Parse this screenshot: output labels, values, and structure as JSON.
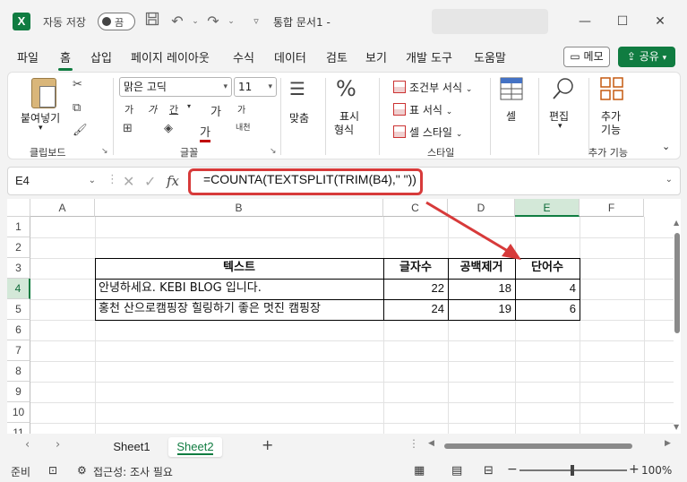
{
  "titlebar": {
    "app_logo": "X",
    "autosave_label": "자동 저장",
    "autosave_toggle": "끔",
    "doc_title": "통합 문서1",
    "doc_title_suffix": "-",
    "icons": [
      "save-icon",
      "undo-icon",
      "redo-icon"
    ]
  },
  "menu": {
    "tabs": [
      "파일",
      "홈",
      "삽입",
      "페이지 레이아웃",
      "수식",
      "데이터",
      "검토",
      "보기",
      "개발 도구",
      "도움말"
    ],
    "active_tab": "홈",
    "memo_label": "메모",
    "share_label": "공유"
  },
  "ribbon": {
    "clipboard": {
      "paste_label": "붙여넣기",
      "group_label": "클립보드"
    },
    "font": {
      "font_name": "맑은 고딕",
      "font_size": "11",
      "grow": "가",
      "shrink": "가",
      "underline": "간",
      "bold": "가",
      "italic": "가",
      "font_color_char": "가",
      "phonetic": "내천",
      "group_label": "글꼴"
    },
    "alignment": {
      "label": "맞춤"
    },
    "number": {
      "label_line1": "표시",
      "label_line2": "형식"
    },
    "styles": {
      "conditional": "조건부 서식",
      "table_format": "표 서식",
      "cell_style": "셀 스타일",
      "group_label": "스타일"
    },
    "cells": {
      "label": "셀"
    },
    "editing": {
      "label": "편집"
    },
    "addins": {
      "label_line1": "추가",
      "label_line2": "기능",
      "group_label": "추가 기능"
    }
  },
  "formula_bar": {
    "name_box": "E4",
    "fx": "fx",
    "formula": "=COUNTA(TEXTSPLIT(TRIM(B4),\" \"))"
  },
  "grid": {
    "columns": [
      "A",
      "B",
      "C",
      "D",
      "E",
      "F"
    ],
    "rows": [
      "1",
      "2",
      "3",
      "4",
      "5",
      "6",
      "7",
      "8",
      "9",
      "10",
      "11"
    ],
    "active_column": "E",
    "active_row": "4",
    "table": {
      "headers": [
        "텍스트",
        "글자수",
        "공백제거",
        "단어수"
      ],
      "rows": [
        [
          "안녕하세요. KEBI BLOG 입니다.",
          "22",
          "18",
          "4"
        ],
        [
          "홍천 산으로캠핑장 힐링하기 좋은 멋진 캠핑장",
          "24",
          "19",
          "6"
        ]
      ]
    }
  },
  "sheets": {
    "tabs": [
      "Sheet1",
      "Sheet2"
    ],
    "active": "Sheet2",
    "add_label": "+"
  },
  "status": {
    "ready": "준비",
    "accessibility": "접근성: 조사 필요",
    "zoom": "100%"
  },
  "colors": {
    "accent": "#107c41",
    "highlight": "#d73a3a"
  }
}
